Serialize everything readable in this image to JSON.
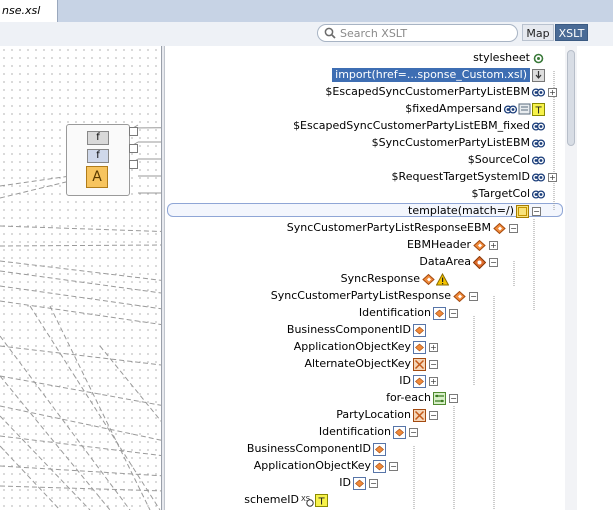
{
  "tab": {
    "title": "nse.xsl"
  },
  "toolbar": {
    "search_placeholder": "Search XSLT",
    "map_label": "Map",
    "xslt_label": "XSLT"
  },
  "functoids": [
    {
      "glyph": "f"
    },
    {
      "glyph": "f"
    },
    {
      "glyph": "A"
    }
  ],
  "tree": [
    {
      "label": "stylesheet",
      "icon": "stylesheet-icon"
    },
    {
      "label": "import(href=...sponse_Custom.xsl)",
      "icon": "import-icon",
      "selected": true
    },
    {
      "label": "$EscapedSyncCustomerPartyListEBM",
      "icon": "variable-icon"
    },
    {
      "label": "$fixedAmpersand",
      "icon": "variable-icon"
    },
    {
      "label": "$EscapedSyncCustomerPartyListEBM_fixed",
      "icon": "variable-icon"
    },
    {
      "label": "$SyncCustomerPartyListEBM",
      "icon": "variable-icon"
    },
    {
      "label": "$SourceCol",
      "icon": "variable-icon"
    },
    {
      "label": "$RequestTargetSystemID",
      "icon": "variable-icon"
    },
    {
      "label": "$TargetCol",
      "icon": "variable-icon"
    },
    {
      "label": "template(match=/)",
      "icon": "template-icon"
    },
    {
      "label": "SyncCustomerPartyListResponseEBM",
      "icon": "element-icon"
    },
    {
      "label": "EBMHeader",
      "icon": "element-icon"
    },
    {
      "label": "DataArea",
      "icon": "element-icon"
    },
    {
      "label": "SyncResponse",
      "icon": "warning-icon"
    },
    {
      "label": "SyncCustomerPartyListResponse",
      "icon": "element-icon"
    },
    {
      "label": "Identification",
      "icon": "element-icon"
    },
    {
      "label": "BusinessComponentID",
      "icon": "element-icon"
    },
    {
      "label": "ApplicationObjectKey",
      "icon": "element-icon"
    },
    {
      "label": "AlternateObjectKey",
      "icon": "element-icon"
    },
    {
      "label": "ID",
      "icon": "element-icon"
    },
    {
      "label": "for-each",
      "icon": "for-each-icon"
    },
    {
      "label": "PartyLocation",
      "icon": "element-icon"
    },
    {
      "label": "Identification",
      "icon": "element-icon"
    },
    {
      "label": "BusinessComponentID",
      "icon": "element-icon"
    },
    {
      "label": "ApplicationObjectKey",
      "icon": "element-icon"
    },
    {
      "label": "ID",
      "icon": "element-icon"
    },
    {
      "label": "schemeID",
      "icon": "attribute-icon"
    }
  ]
}
